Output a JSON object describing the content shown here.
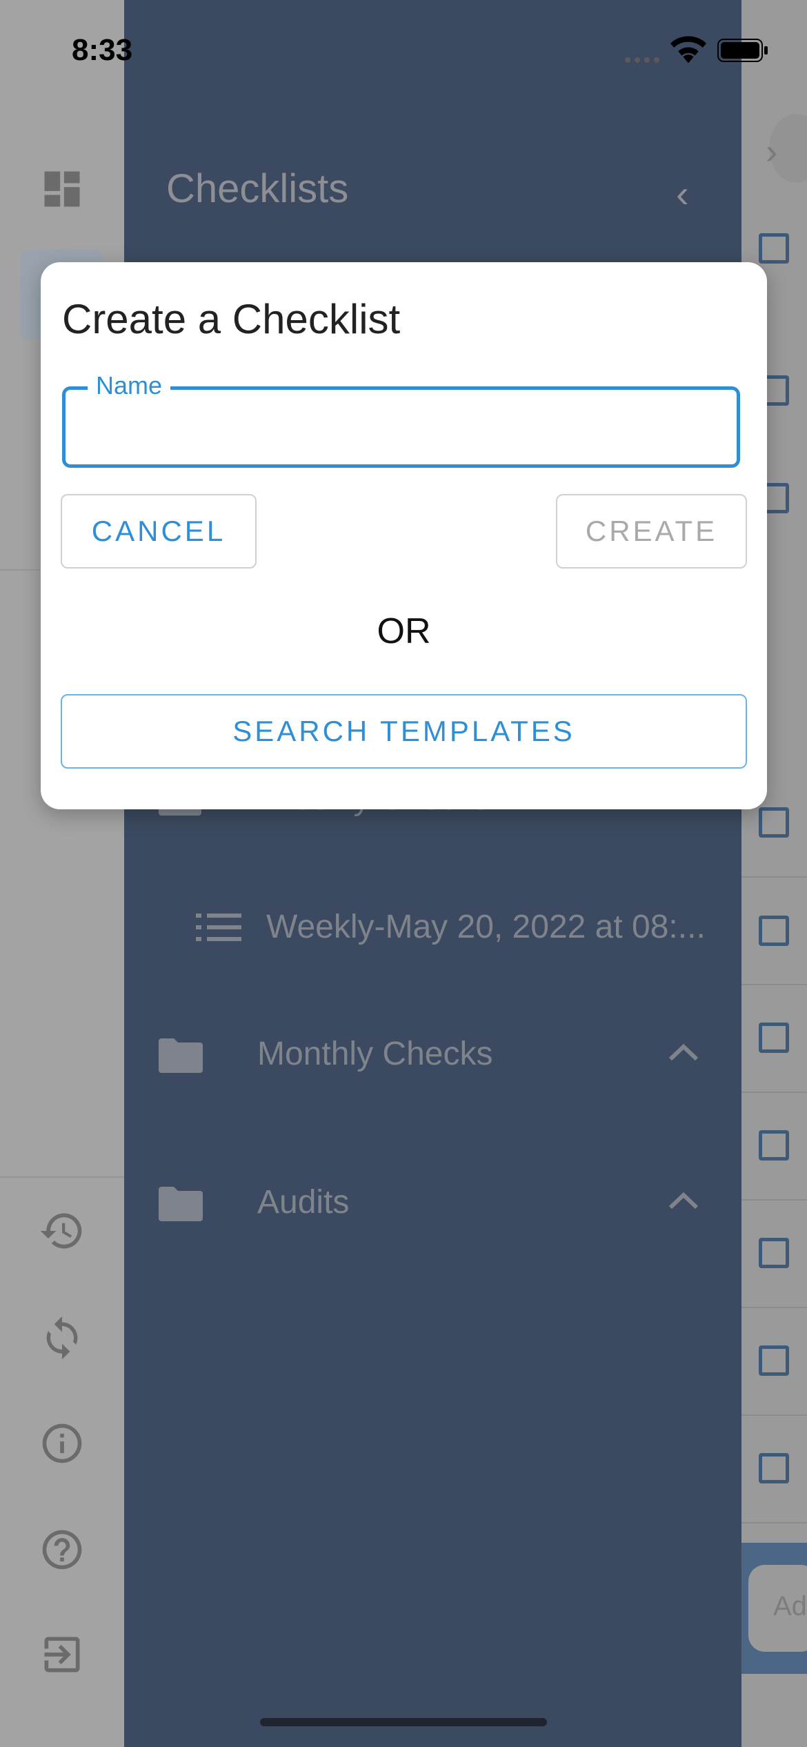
{
  "status_bar": {
    "time": "8:33"
  },
  "drawer": {
    "title": "Checklists",
    "items": [
      {
        "label": "Weekly Checks",
        "icon": "folder-icon"
      },
      {
        "label": "Weekly-May 20, 2022 at 08:...",
        "icon": "list-icon"
      },
      {
        "label": "Monthly Checks",
        "icon": "folder-icon"
      },
      {
        "label": "Audits",
        "icon": "folder-icon"
      }
    ]
  },
  "dialog": {
    "title": "Create a Checklist",
    "name_label": "Name",
    "name_value": "",
    "cancel_label": "CANCEL",
    "create_label": "CREATE",
    "or_text": "OR",
    "search_label": "SEARCH TEMPLATES"
  },
  "right_panel": {
    "add_button_partial": "Ad"
  },
  "colors": {
    "accent": "#2e8fd6",
    "drawer_bg": "#3b4a60",
    "checkbox": "#3e5a79"
  }
}
